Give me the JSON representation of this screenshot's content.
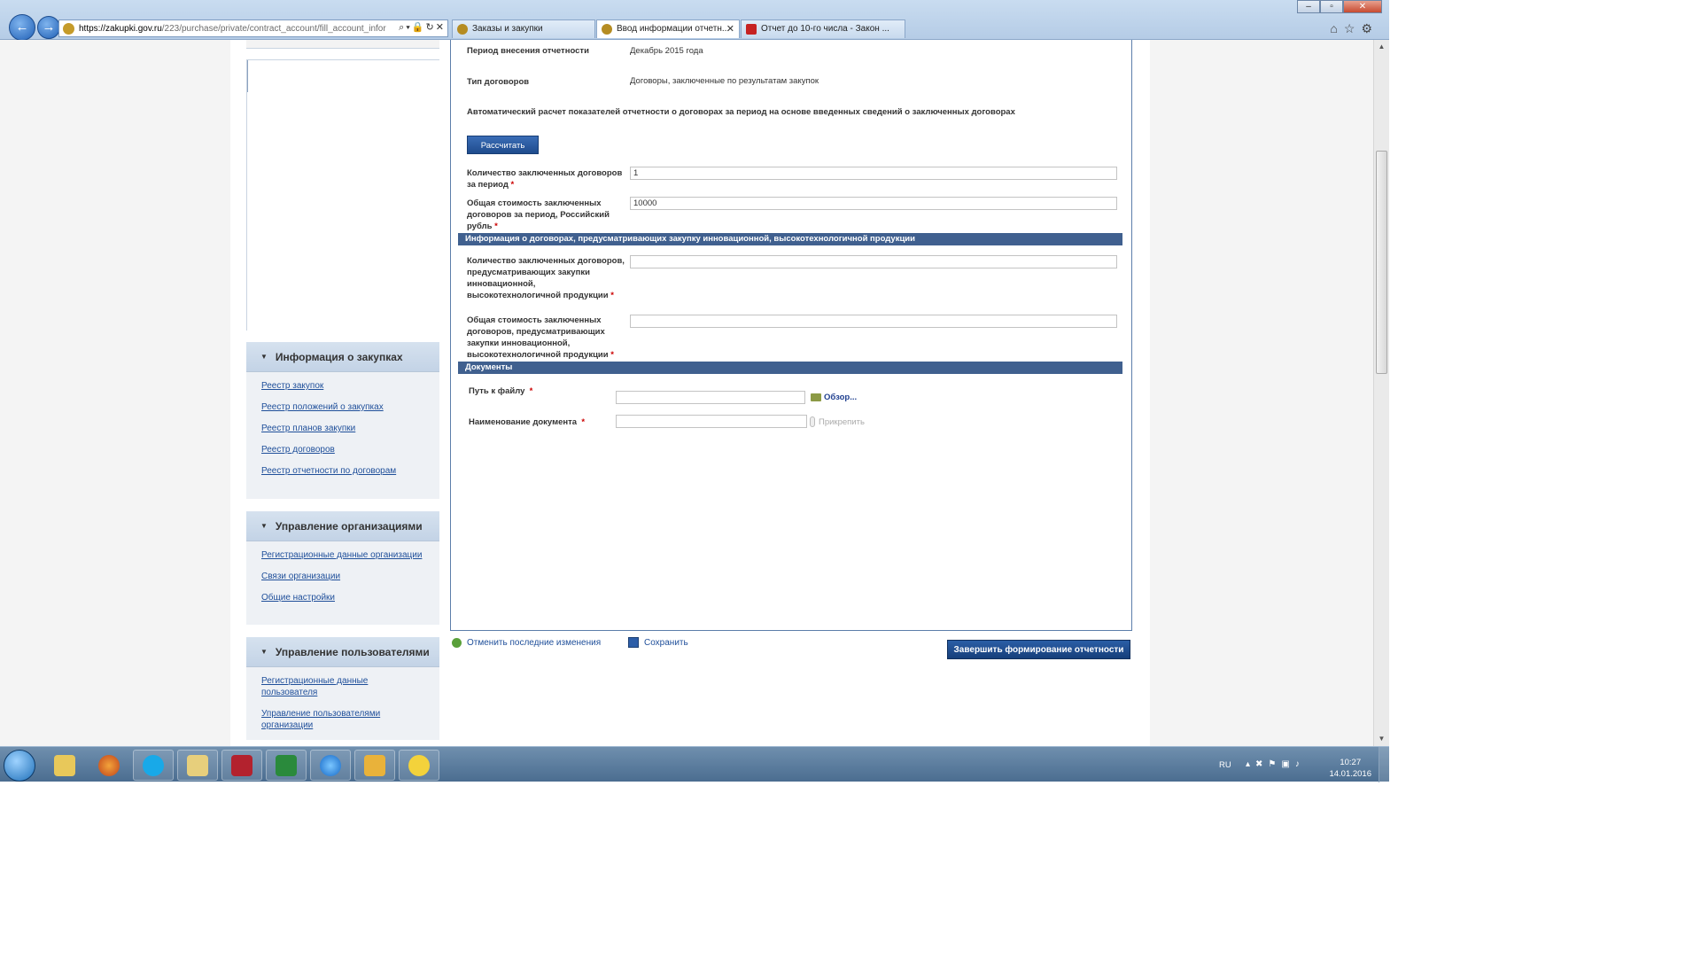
{
  "browser": {
    "url_host": "https://zakupki.gov.ru",
    "url_path": "/223/purchase/private/contract_account/fill_account_infor",
    "tabs": [
      {
        "label": "Заказы и закупки"
      },
      {
        "label": "Ввод информации отчетн..."
      },
      {
        "label": "Отчет до 10-го числа - Закон ..."
      }
    ]
  },
  "sidebar": {
    "sections": [
      {
        "title": "Информация о закупках",
        "items": [
          "Реестр закупок",
          "Реестр положений о закупках",
          "Реестр планов закупки",
          "Реестр договоров",
          "Реестр отчетности по договорам"
        ]
      },
      {
        "title": "Управление организациями",
        "items": [
          "Регистрационные данные организации",
          "Связи организации",
          "Общие настройки"
        ]
      },
      {
        "title": "Управление пользователями",
        "items": [
          "Регистрационные данные пользователя",
          "Управление пользователями организации"
        ]
      }
    ]
  },
  "form": {
    "period_label": "Период внесения отчетности",
    "period_value": "Декабрь 2015 года",
    "type_label": "Тип договоров",
    "type_value": "Договоры, заключенные по результатам закупок",
    "auto_calc_text": "Автоматический расчет показателей отчетности о договорах за период на основе введенных сведений о заключенных договорах",
    "calc_button": "Рассчитать",
    "count_label_1": "Количество заключенных договоров",
    "count_label_2": "за период",
    "count_value": "1",
    "total_label_1": "Общая стоимость заключенных",
    "total_label_2": "договоров за период, Российский",
    "total_label_3": "рубль",
    "total_value": "10000",
    "innov_band": "Информация о договорах, предусматривающих закупку инновационной, высокотехнологичной продукции",
    "innov_count_label_1": "Количество заключенных договоров,",
    "innov_count_label_2": "предусматривающих закупки",
    "innov_count_label_3": "инновационной,",
    "innov_count_label_4": "высокотехнологичной продукции",
    "innov_count_value": "",
    "innov_total_label_1": "Общая стоимость заключенных",
    "innov_total_label_2": "договоров, предусматривающих",
    "innov_total_label_3": "закупки инновационной,",
    "innov_total_label_4": "высокотехнологичной продукции",
    "innov_total_value": "",
    "docs_band": "Документы",
    "path_label": "Путь к файлу",
    "browse_link": "Обзор...",
    "docname_label": "Наименование документа",
    "attach_link": "Прикрепить",
    "required_mark": "*"
  },
  "actions": {
    "undo": "Отменить последние изменения",
    "save": "Сохранить",
    "finish": "Завершить формирование отчетности"
  },
  "taskbar": {
    "lang": "RU",
    "time": "10:27",
    "date": "14.01.2016"
  },
  "colors": {
    "band": "#40608f",
    "link": "#1f4f9a",
    "button": "#1f4b8d"
  }
}
